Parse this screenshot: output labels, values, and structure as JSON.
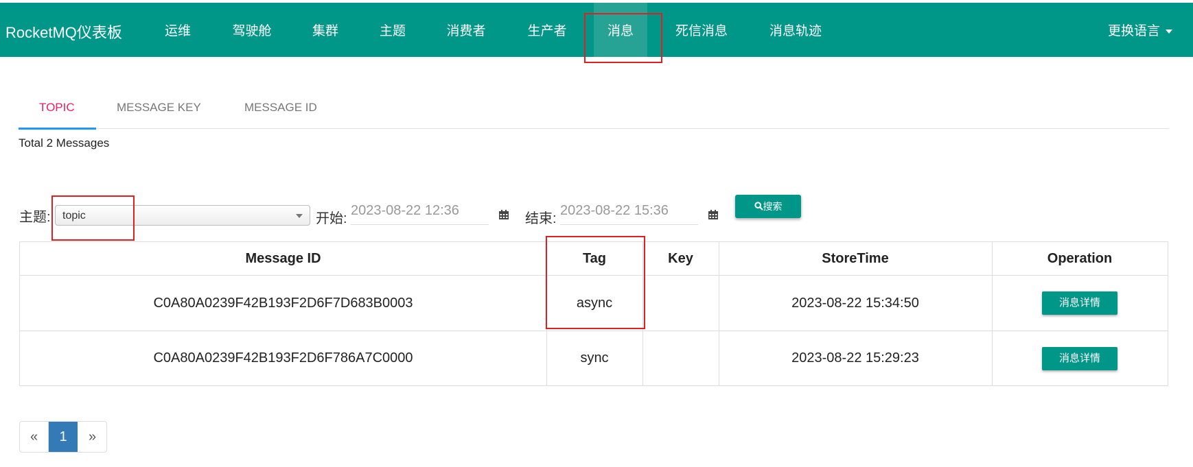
{
  "navbar": {
    "brand": "RocketMQ仪表板",
    "items": [
      "运维",
      "驾驶舱",
      "集群",
      "主题",
      "消费者",
      "生产者",
      "消息",
      "死信消息",
      "消息轨迹"
    ],
    "active": "消息",
    "language": "更换语言"
  },
  "tabs": [
    "TOPIC",
    "MESSAGE KEY",
    "MESSAGE ID"
  ],
  "active_tab": "TOPIC",
  "summary": "Total 2 Messages",
  "filters": {
    "topic_label": "主题:",
    "topic_value": "topic",
    "start_label": "开始:",
    "start_value": "2023-08-22 12:36",
    "end_label": "结束:",
    "end_value": "2023-08-22 15:36",
    "search_button": "搜索"
  },
  "table": {
    "columns": [
      "Message ID",
      "Tag",
      "Key",
      "StoreTime",
      "Operation"
    ],
    "rows": [
      {
        "message_id": "C0A80A0239F42B193F2D6F7D683B0003",
        "tag": "async",
        "key": "",
        "store_time": "2023-08-22 15:34:50",
        "action": "消息详情"
      },
      {
        "message_id": "C0A80A0239F42B193F2D6F786A7C0000",
        "tag": "sync",
        "key": "",
        "store_time": "2023-08-22 15:29:23",
        "action": "消息详情"
      }
    ]
  },
  "pagination": {
    "prev": "«",
    "current": "1",
    "next": "»"
  },
  "colors": {
    "primary": "#009688",
    "active_tab": "#e91e63",
    "tab_underline": "#2196f3",
    "highlight_box": "#e02020",
    "page_active": "#337ab7"
  },
  "icons": [
    "calendar-icon",
    "search-icon",
    "caret-down-icon"
  ]
}
